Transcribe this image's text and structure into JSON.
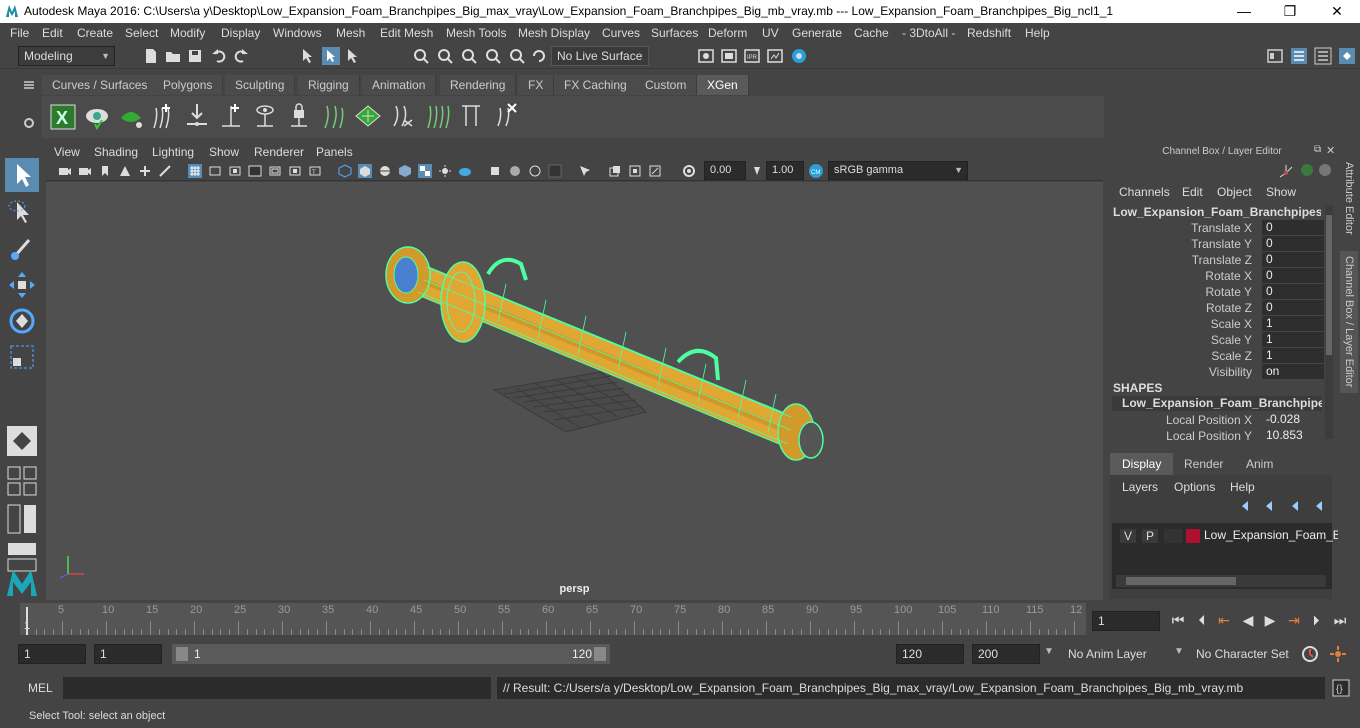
{
  "titlebar": {
    "title": "Autodesk Maya 2016: C:\\Users\\a y\\Desktop\\Low_Expansion_Foam_Branchpipes_Big_max_vray\\Low_Expansion_Foam_Branchpipes_Big_mb_vray.mb   ---   Low_Expansion_Foam_Branchpipes_Big_ncl1_1",
    "minimize": "—",
    "maximize": "❐",
    "close": "✕"
  },
  "menubar": [
    "File",
    "Edit",
    "Create",
    "Select",
    "Modify",
    "Display",
    "Windows",
    "Mesh",
    "Edit Mesh",
    "Mesh Tools",
    "Mesh Display",
    "Curves",
    "Surfaces",
    "Deform",
    "UV",
    "Generate",
    "Cache",
    "- 3DtoAll -",
    "Redshift",
    "Help"
  ],
  "status": {
    "mode": "Modeling",
    "live_surface": "No Live Surface"
  },
  "shelf_tabs": [
    "Curves / Surfaces",
    "Polygons",
    "Sculpting",
    "Rigging",
    "Animation",
    "Rendering",
    "FX",
    "FX Caching",
    "Custom",
    "XGen"
  ],
  "shelf_active": "XGen",
  "viewport": {
    "menus": [
      "View",
      "Shading",
      "Lighting",
      "Show",
      "Renderer",
      "Panels"
    ],
    "exposure": "0.00",
    "gamma": "1.00",
    "color_space": "sRGB gamma",
    "camera": "persp"
  },
  "channel_box": {
    "title": "Channel Box / Layer Editor",
    "menus": [
      "Channels",
      "Edit",
      "Object",
      "Show"
    ],
    "object_name": "Low_Expansion_Foam_Branchpipes_B...",
    "attributes": [
      {
        "name": "Translate X",
        "value": "0"
      },
      {
        "name": "Translate Y",
        "value": "0"
      },
      {
        "name": "Translate Z",
        "value": "0"
      },
      {
        "name": "Rotate X",
        "value": "0"
      },
      {
        "name": "Rotate Y",
        "value": "0"
      },
      {
        "name": "Rotate Z",
        "value": "0"
      },
      {
        "name": "Scale X",
        "value": "1"
      },
      {
        "name": "Scale Y",
        "value": "1"
      },
      {
        "name": "Scale Z",
        "value": "1"
      },
      {
        "name": "Visibility",
        "value": "on"
      }
    ],
    "shapes_label": "SHAPES",
    "shape_name": "Low_Expansion_Foam_Branchpipes_...",
    "shape_attrs": [
      {
        "name": "Local Position X",
        "value": "-0.028"
      },
      {
        "name": "Local Position Y",
        "value": "10.853"
      }
    ]
  },
  "layer_editor": {
    "tabs": [
      "Display",
      "Render",
      "Anim"
    ],
    "menus": [
      "Layers",
      "Options",
      "Help"
    ],
    "layer": {
      "v": "V",
      "p": "P",
      "name": "Low_Expansion_Foam_Br",
      "color": "#b01030"
    }
  },
  "side_tabs": [
    "Attribute Editor",
    "Channel Box / Layer Editor"
  ],
  "timeline": {
    "ticks": [
      "5",
      "10",
      "15",
      "20",
      "25",
      "30",
      "35",
      "40",
      "45",
      "50",
      "55",
      "60",
      "65",
      "70",
      "75",
      "80",
      "85",
      "90",
      "95",
      "100",
      "105",
      "110",
      "115",
      "12"
    ],
    "start_label": "1",
    "current_frame": "1"
  },
  "range": {
    "start": "1",
    "playback_start": "1",
    "slider_start": "1",
    "slider_end": "120",
    "end": "120",
    "max": "200",
    "anim_layer": "No Anim Layer",
    "char_set": "No Character Set"
  },
  "cmdline": {
    "label": "MEL",
    "result": "// Result: C:/Users/a y/Desktop/Low_Expansion_Foam_Branchpipes_Big_max_vray/Low_Expansion_Foam_Branchpipes_Big_mb_vray.mb"
  },
  "help": "Select Tool: select an object",
  "colors": {
    "accent": "#5a8bb0",
    "wire": "#4dffa0",
    "body": "#e0a832"
  }
}
